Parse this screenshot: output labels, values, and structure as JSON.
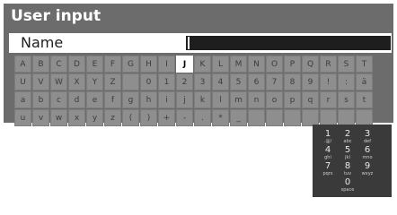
{
  "dialog": {
    "title": "User input",
    "name_label": "Name",
    "name_value": ""
  },
  "keyboard": {
    "selected": "J",
    "rows": [
      [
        "A",
        "B",
        "C",
        "D",
        "E",
        "F",
        "G",
        "H",
        "I",
        "J",
        "K",
        "L",
        "M",
        "N",
        "O",
        "P",
        "Q",
        "R",
        "S",
        "T"
      ],
      [
        "U",
        "V",
        "W",
        "X",
        "Y",
        "Z",
        "",
        "0",
        "1",
        "2",
        "3",
        "4",
        "5",
        "6",
        "7",
        "8",
        "9",
        "!",
        ":",
        "ä"
      ],
      [
        "a",
        "b",
        "c",
        "d",
        "e",
        "f",
        "g",
        "h",
        "i",
        "j",
        "k",
        "l",
        "m",
        "n",
        "o",
        "p",
        "q",
        "r",
        "s",
        "t"
      ],
      [
        "u",
        "v",
        "w",
        "x",
        "y",
        "z",
        "(",
        ")",
        "+",
        "-",
        ".",
        "*",
        "_",
        "",
        "",
        "",
        "",
        "",
        "",
        ""
      ]
    ]
  },
  "numpad": {
    "keys": [
      {
        "num": "1",
        "sub": ".@/"
      },
      {
        "num": "2",
        "sub": "abc"
      },
      {
        "num": "3",
        "sub": "def"
      },
      {
        "num": "4",
        "sub": "ghi"
      },
      {
        "num": "5",
        "sub": "jkl"
      },
      {
        "num": "6",
        "sub": "mno"
      },
      {
        "num": "7",
        "sub": "pqrs"
      },
      {
        "num": "8",
        "sub": "tuv"
      },
      {
        "num": "9",
        "sub": "wxyz"
      },
      {
        "num": "0",
        "sub": "space"
      }
    ]
  },
  "colors": {
    "panel": "#6c6c6c",
    "key": "#8e8e8e",
    "selected_key": "#ffffff",
    "name_field": "#1e1e1e",
    "numpad": "#3a3a3a"
  }
}
